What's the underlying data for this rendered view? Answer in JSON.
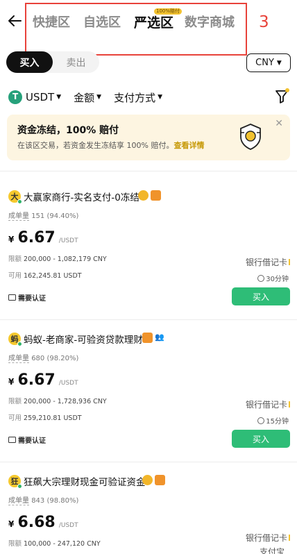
{
  "nav": {
    "tabs": [
      {
        "label": "快捷区",
        "active": false
      },
      {
        "label": "自选区",
        "active": false
      },
      {
        "label": "严选区",
        "active": true,
        "badge": "100%赔付"
      },
      {
        "label": "数字商城",
        "active": false
      }
    ],
    "annotation": "3"
  },
  "trade_toggle": {
    "buy": "买入",
    "sell": "卖出",
    "selected": "buy"
  },
  "currency": "CNY",
  "filters": {
    "coin": "USDT",
    "amount": "金额",
    "payment": "支付方式"
  },
  "banner": {
    "title": "资金冻结，100% 赔付",
    "subtitle": "在该区交易，若资金发生冻结享 100% 赔付。",
    "link": "查看详情"
  },
  "listings": [
    {
      "avatar": "大",
      "name": "大赢家商行-实名支付-0冻结",
      "badges": [
        "gold",
        "shield"
      ],
      "stats_label": "成单量",
      "stats_value": "151 (94.40%)",
      "currency_symbol": "¥",
      "price": "6.67",
      "price_unit": "/USDT",
      "limit_label": "限额",
      "limit": "200,000 - 1,082,179 CNY",
      "available_label": "可用",
      "available": "162,245.81 USDT",
      "kyc": "需要认证",
      "payment": "银行借记卡",
      "time": "30分钟",
      "button": "买入"
    },
    {
      "avatar": "蚂",
      "name": "蚂蚁-老商家-可验资贷款理财",
      "badges": [
        "shield",
        "people"
      ],
      "stats_label": "成单量",
      "stats_value": "680 (98.20%)",
      "currency_symbol": "¥",
      "price": "6.67",
      "price_unit": "/USDT",
      "limit_label": "限额",
      "limit": "200,000 - 1,728,936 CNY",
      "available_label": "可用",
      "available": "259,210.81 USDT",
      "kyc": "需要认证",
      "payment": "银行借记卡",
      "time": "15分钟",
      "button": "买入"
    },
    {
      "avatar": "狂",
      "name": "狂飙大宗理财现金可验证资金",
      "badges": [
        "gold",
        "shield"
      ],
      "stats_label": "成单量",
      "stats_value": "843 (98.80%)",
      "currency_symbol": "¥",
      "price": "6.68",
      "price_unit": "/USDT",
      "limit_label": "限额",
      "limit": "100,000 - 247,120 CNY",
      "payment": "银行借记卡",
      "payment2": "支付宝"
    }
  ],
  "colors": {
    "accent_green": "#2ebd77",
    "highlight_red": "#e8423a",
    "gold": "#f2c230"
  }
}
